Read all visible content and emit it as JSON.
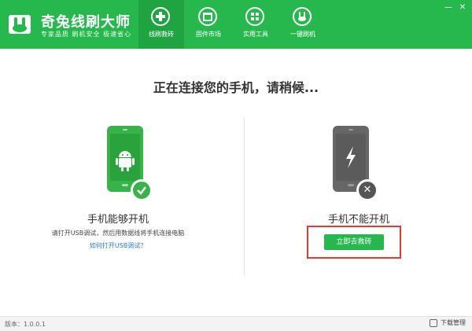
{
  "app": {
    "title": "奇兔线刷大师",
    "subtitle": "专家品质  刷机安全  极速省心"
  },
  "nav": {
    "items": [
      {
        "label": "线刷救砖",
        "icon": "plus-cross-icon"
      },
      {
        "label": "固件市场",
        "icon": "store-icon"
      },
      {
        "label": "实用工具",
        "icon": "grid-icon"
      },
      {
        "label": "一键刷机",
        "icon": "rabbit-icon"
      }
    ],
    "active_index": 0
  },
  "window_controls": {
    "minimize": "—",
    "close": "✕"
  },
  "main": {
    "heading": "正在连接您的手机，请稍候..."
  },
  "left_panel": {
    "title": "手机能够开机",
    "description": "请打开USB调试，然后用数据线将手机连接电脑",
    "link": "如何打开USB调试？",
    "icon": "android-phone-icon"
  },
  "right_panel": {
    "title": "手机不能开机",
    "button": "立即去救砖",
    "icon": "dead-phone-icon"
  },
  "footer": {
    "version": "版本：1.0.0.1",
    "download_manager": "下载管理"
  },
  "colors": {
    "brand_green": "#27b84d",
    "highlight_red": "#e53935",
    "link_blue": "#2b7ad0"
  }
}
